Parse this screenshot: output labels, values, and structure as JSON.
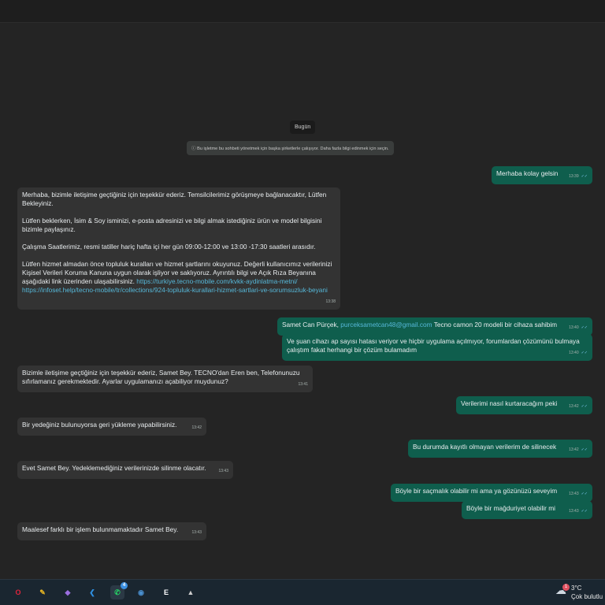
{
  "chat": {
    "date_label": "Bugün",
    "notice": "ⓘ Bu işletme bu sohbeti yönetmek için başka şirketlerle çalışıyor. Daha fazla bilgi edinmek için seçin.",
    "messages": [
      {
        "dir": "out",
        "text": "Merhaba kolay gelsin",
        "time": "13:39"
      },
      {
        "dir": "in",
        "paragraphs": [
          "Merhaba, bizimle iletişime geçtiğiniz için teşekkür ederiz.  Temsilcilerimiz görüşmeye bağlanacaktır, Lütfen Bekleyiniz.",
          "Lütfen beklerken, İsim & Soy isminizi, e-posta adresinizi ve bilgi almak istediğiniz ürün ve model bilgisini bizimle paylaşınız.",
          "Çalışma Saatlerimiz, resmi tatiller hariç hafta içi her gün 09:00-12:00 ve 13:00 -17:30 saatleri arasıdır.",
          "Lütfen hizmet almadan önce topluluk kuralları ve hizmet şartlarını okuyunuz. Değerli kullanıcımız verilerinizi Kişisel Verileri Koruma Kanuna uygun olarak işliyor ve saklıyoruz. Ayrıntılı bilgi ve Açık Rıza Beyanına aşağıdaki link üzerinden ulaşabilirsiniz. "
        ],
        "links": [
          "https://turkiye.tecno-mobile.com/kvkk-aydinlatma-metni/",
          "https://infoset.help/tecno-mobile/tr/collections/924-topluluk-kurallari-hizmet-sartlari-ve-sorumsuzluk-beyani"
        ],
        "time": "13:38"
      },
      {
        "dir": "out",
        "text_pre": "Samet Can Pürçek, ",
        "email": "purceksametcan48@gmail.com",
        "text_post": " Tecno camon 20 modeli bir cihaza sahibim",
        "time": "13:40"
      },
      {
        "dir": "out",
        "text": "Ve şuan cihazı ap sayısı hatası veriyor ve hiçbir uygulama açılmıyor, forumlardan çözümünü bulmaya çalıştım fakat herhangi bir çözüm bulamadım",
        "time": "13:40"
      },
      {
        "dir": "in",
        "text": "Bizimle iletişime geçtiğiniz için teşekkür ederiz, Samet Bey. TECNO'dan Eren ben, Telefonunuzu sıfırlamanız gerekmektedir. Ayarlar uygulamanızı açabiliyor muydunuz?",
        "time": "13:41"
      },
      {
        "dir": "out",
        "text": "Verilerimi nasıl kurtaracağım peki",
        "time": "13:42"
      },
      {
        "dir": "in",
        "text": "Bir yedeğiniz bulunuyorsa geri yükleme yapabilirsiniz.",
        "time": "13:42"
      },
      {
        "dir": "out",
        "text": "Bu durumda kayıtlı olmayan verilerim de silinecek",
        "time": "13:42"
      },
      {
        "dir": "in",
        "text": "Evet Samet Bey. Yedeklemediğiniz verilerinizde silinme olacatır.",
        "time": "13:43"
      },
      {
        "dir": "out",
        "text": "Böyle bir saçmalık olabilir mi ama ya gözünüzü seveyim",
        "time": "13:43"
      },
      {
        "dir": "out",
        "text": "Böyle bir mağduriyet olabilir mi",
        "time": "13:43"
      },
      {
        "dir": "in",
        "text": "Maalesef farklı bir işlem bulunmamaktadır Samet Bey.",
        "time": "13:43"
      }
    ],
    "ticks": "✓✓"
  },
  "taskbar": {
    "apps": [
      {
        "name": "opera",
        "glyph": "O",
        "color": "#e0243c"
      },
      {
        "name": "photo-editor",
        "glyph": "✎",
        "color": "#e8b623"
      },
      {
        "name": "visual-studio",
        "glyph": "◆",
        "color": "#9b6fe0"
      },
      {
        "name": "vscode",
        "glyph": "❮",
        "color": "#2f8fe0"
      },
      {
        "name": "whatsapp",
        "glyph": "✆",
        "color": "#25d366",
        "badge": "4"
      },
      {
        "name": "steam",
        "glyph": "◉",
        "color": "#4a90d0"
      },
      {
        "name": "epic-games",
        "glyph": "E",
        "color": "#ffffff"
      },
      {
        "name": "game-launcher",
        "glyph": "▲",
        "color": "#cccccc"
      }
    ],
    "weather": {
      "badge": "1",
      "temp": "3°C",
      "desc": "Çok bulutlu"
    }
  }
}
